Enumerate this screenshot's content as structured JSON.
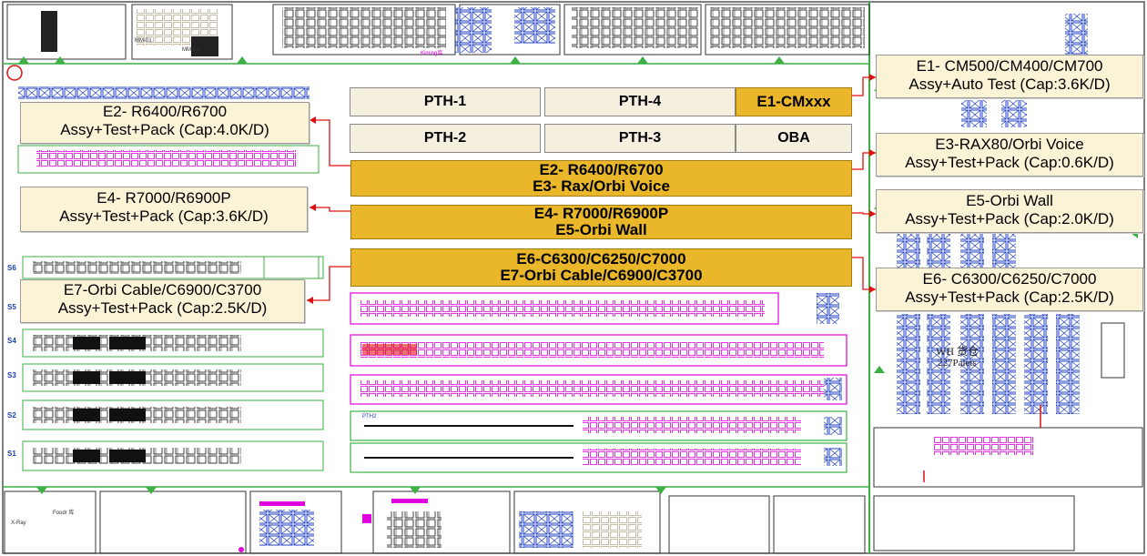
{
  "production_lines": {
    "pth1": "PTH-1",
    "pth4": "PTH-4",
    "pth2": "PTH-2",
    "pth3": "PTH-3",
    "e1": "E1-CMxxx",
    "oba": "OBA",
    "gold_row1_a": "E2- R6400/R6700",
    "gold_row1_b": "E3- Rax/Orbi Voice",
    "gold_row2_a": "E4- R7000/R6900P",
    "gold_row2_b": "E5-Orbi Wall",
    "gold_row3_a": "E6-C6300/C6250/C7000",
    "gold_row3_b": "E7-Orbi Cable/C6900/C3700"
  },
  "callouts": {
    "e1": {
      "l1": "E1- CM500/CM400/CM700",
      "l2": "Assy+Auto Test (Cap:3.6K/D)"
    },
    "e2": {
      "l1": "E2- R6400/R6700",
      "l2": "Assy+Test+Pack (Cap:4.0K/D)"
    },
    "e3": {
      "l1": "E3-RAX80/Orbi Voice",
      "l2": "Assy+Test+Pack (Cap:0.6K/D)"
    },
    "e4": {
      "l1": "E4- R7000/R6900P",
      "l2": "Assy+Test+Pack (Cap:3.6K/D)"
    },
    "e5": {
      "l1": "E5-Orbi Wall",
      "l2": "Assy+Test+Pack (Cap:2.0K/D)"
    },
    "e6": {
      "l1": "E6- C6300/C6250/C7000",
      "l2": "Assy+Test+Pack (Cap:2.5K/D)"
    },
    "e7": {
      "l1": "E7-Orbi Cable/C6900/C3700",
      "l2": "Assy+Test+Pack (Cap:2.5K/D)"
    }
  },
  "smt_labels": [
    "S6",
    "S5",
    "S4",
    "S3",
    "S2",
    "S1"
  ],
  "warehouse": {
    "line1": "WH 货仓",
    "line2": "227Palets"
  },
  "misc": {
    "xray": "X-Ray",
    "kiming": "Kiming库",
    "mm01": "MM-01",
    "mm02": "MM-02",
    "pth_tag": "PTH2",
    "foodr": "Foodr 库"
  },
  "colors": {
    "green": "#3cb043",
    "magenta": "#e000e0",
    "blue": "#1f3fbf",
    "red": "#e01010",
    "gold": "#e9b729",
    "callout_bg": "#fbf3d6"
  }
}
